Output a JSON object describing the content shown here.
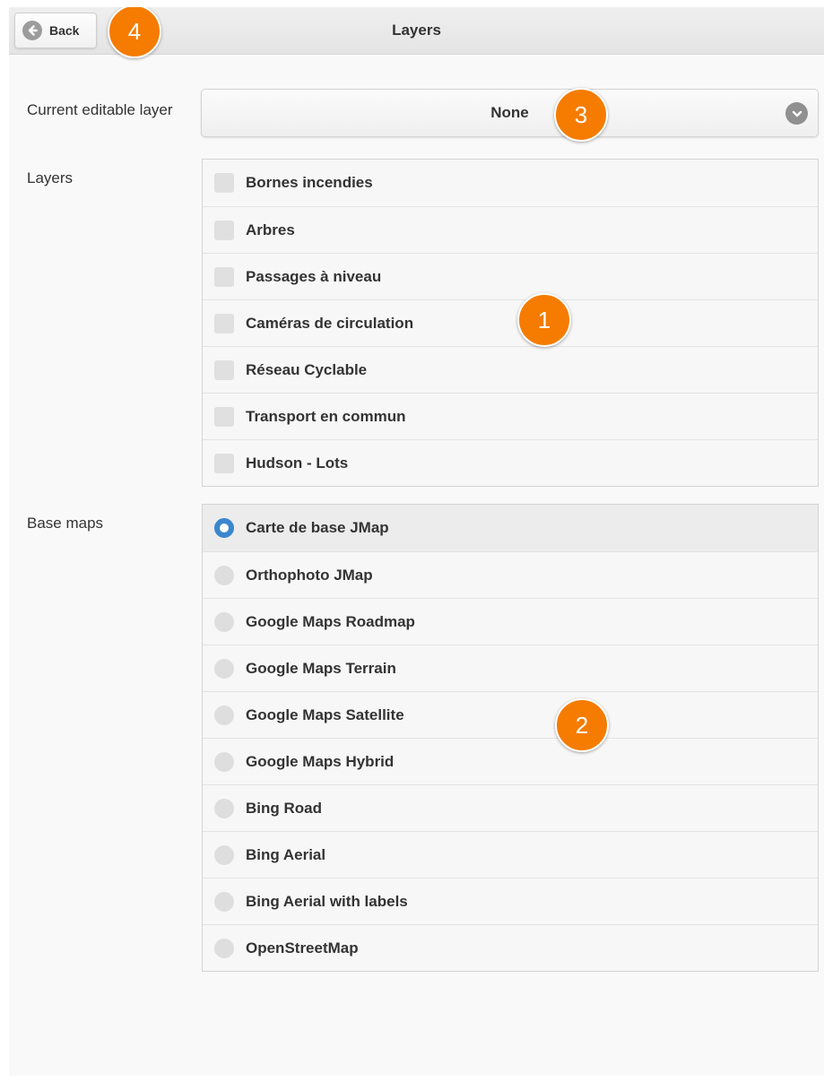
{
  "header": {
    "title": "Layers",
    "back_label": "Back"
  },
  "editable": {
    "label": "Current editable layer",
    "value": "None"
  },
  "layers": {
    "label": "Layers",
    "items": [
      {
        "label": "Bornes incendies",
        "checked": false
      },
      {
        "label": "Arbres",
        "checked": false
      },
      {
        "label": "Passages à niveau",
        "checked": false
      },
      {
        "label": "Caméras de circulation",
        "checked": false
      },
      {
        "label": "Réseau Cyclable",
        "checked": false
      },
      {
        "label": "Transport en commun",
        "checked": false
      },
      {
        "label": "Hudson - Lots",
        "checked": false
      }
    ]
  },
  "basemaps": {
    "label": "Base maps",
    "items": [
      {
        "label": "Carte de base JMap",
        "selected": true
      },
      {
        "label": "Orthophoto JMap",
        "selected": false
      },
      {
        "label": "Google Maps Roadmap",
        "selected": false
      },
      {
        "label": "Google Maps Terrain",
        "selected": false
      },
      {
        "label": "Google Maps Satellite",
        "selected": false
      },
      {
        "label": "Google Maps Hybrid",
        "selected": false
      },
      {
        "label": "Bing Road",
        "selected": false
      },
      {
        "label": "Bing Aerial",
        "selected": false
      },
      {
        "label": "Bing Aerial with labels",
        "selected": false
      },
      {
        "label": "OpenStreetMap",
        "selected": false
      }
    ]
  },
  "callouts": {
    "one": "1",
    "two": "2",
    "three": "3",
    "four": "4"
  },
  "colors": {
    "callout": "#f57c00",
    "radio_selected": "#3a86cf"
  }
}
